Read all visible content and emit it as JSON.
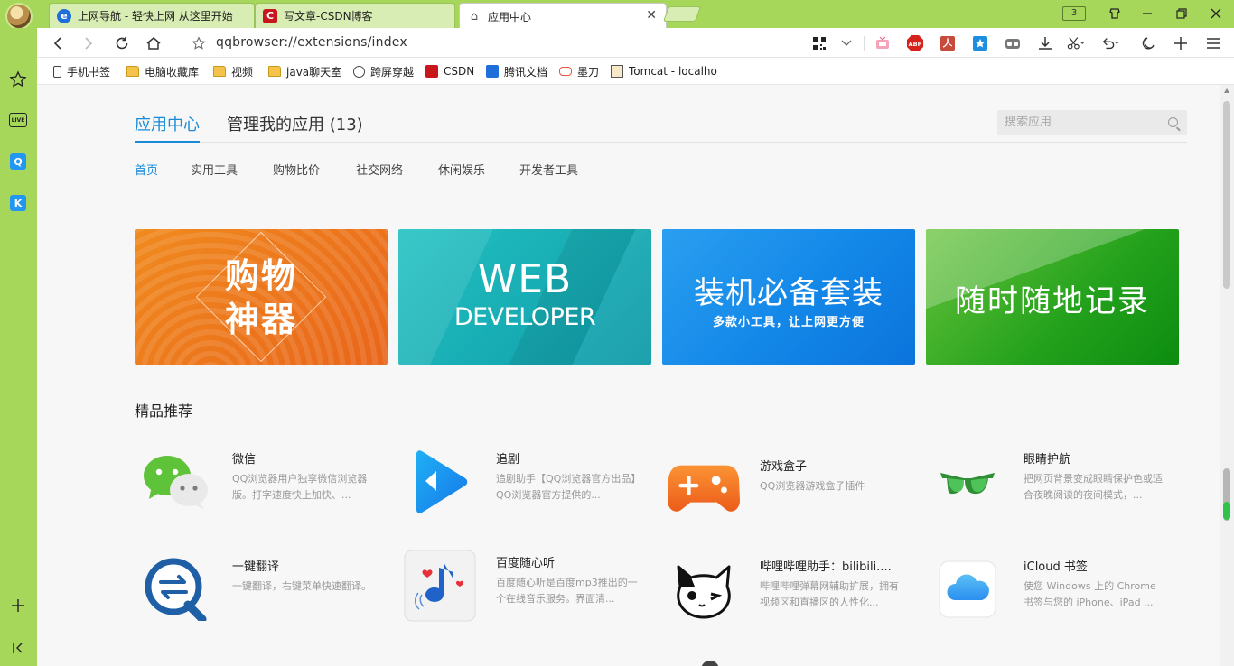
{
  "tabs": [
    {
      "label": "上网导航 - 轻快上网 从这里开始",
      "icon": "ie-icon"
    },
    {
      "label": "写文章-CSDN博客",
      "icon": "csdn-icon"
    },
    {
      "label": "应用中心",
      "icon": "puzzle-icon",
      "close": "✕"
    }
  ],
  "tab_count": "3",
  "address": {
    "url": "qqbrowser://extensions/index"
  },
  "bookmarks": [
    {
      "label": "手机书签",
      "icon": "phone-icon"
    },
    {
      "label": "电脑收藏库",
      "icon": "folder-icon"
    },
    {
      "label": "视频",
      "icon": "folder-icon"
    },
    {
      "label": "java聊天室",
      "icon": "folder-icon"
    },
    {
      "label": "跨屏穿越",
      "icon": "globe-icon"
    },
    {
      "label": "CSDN",
      "icon": "csdn-icon"
    },
    {
      "label": "腾讯文档",
      "icon": "tencent-docs-icon"
    },
    {
      "label": "墨刀",
      "icon": "modao-icon"
    },
    {
      "label": "Tomcat - localho",
      "icon": "tomcat-icon"
    }
  ],
  "sidebar": {
    "live_label": "LIVE",
    "q_label": "Q",
    "k_label": "K"
  },
  "main": {
    "tab_app_center": "应用中心",
    "tab_manage": "管理我的应用 (13)",
    "search_placeholder": "搜索应用"
  },
  "categories": [
    "首页",
    "实用工具",
    "购物比价",
    "社交网络",
    "休闲娱乐",
    "开发者工具"
  ],
  "banners": {
    "b1_line1": "购物",
    "b1_line2": "神器",
    "b2_big": "WEB",
    "b2_small": "DEVELOPER",
    "b3_big": "装机必备套装",
    "b3_small": "多款小工具，让上网更方便",
    "b4_text": "随时随地记录"
  },
  "section_title": "精品推荐",
  "apps": [
    {
      "name": "微信",
      "desc": "QQ浏览器用户独享微信浏览器版。打字速度快上加快、..."
    },
    {
      "name": "追剧",
      "desc": "追剧助手【QQ浏览器官方出品】QQ浏览器官方提供的..."
    },
    {
      "name": "游戏盒子",
      "desc": "QQ浏览器游戏盒子插件"
    },
    {
      "name": "眼睛护航",
      "desc": "把网页背景变成眼睛保护色或适合夜晚阅读的夜间模式，..."
    },
    {
      "name": "一键翻译",
      "desc": "一键翻译，右键菜单快速翻译。"
    },
    {
      "name": "百度随心听",
      "desc": "百度随心听是百度mp3推出的一个在线音乐服务。界面清..."
    },
    {
      "name": "哔哩哔哩助手：bilibili....",
      "desc": "哔哩哔哩弹幕网辅助扩展，拥有视频区和直播区的人性化..."
    },
    {
      "name": "iCloud 书签",
      "desc": "使您 Windows 上的 Chrome 书签与您的 iPhone、iPad ..."
    }
  ],
  "colors": {
    "accent": "#1a8bd8",
    "frame": "#a6d65a"
  }
}
